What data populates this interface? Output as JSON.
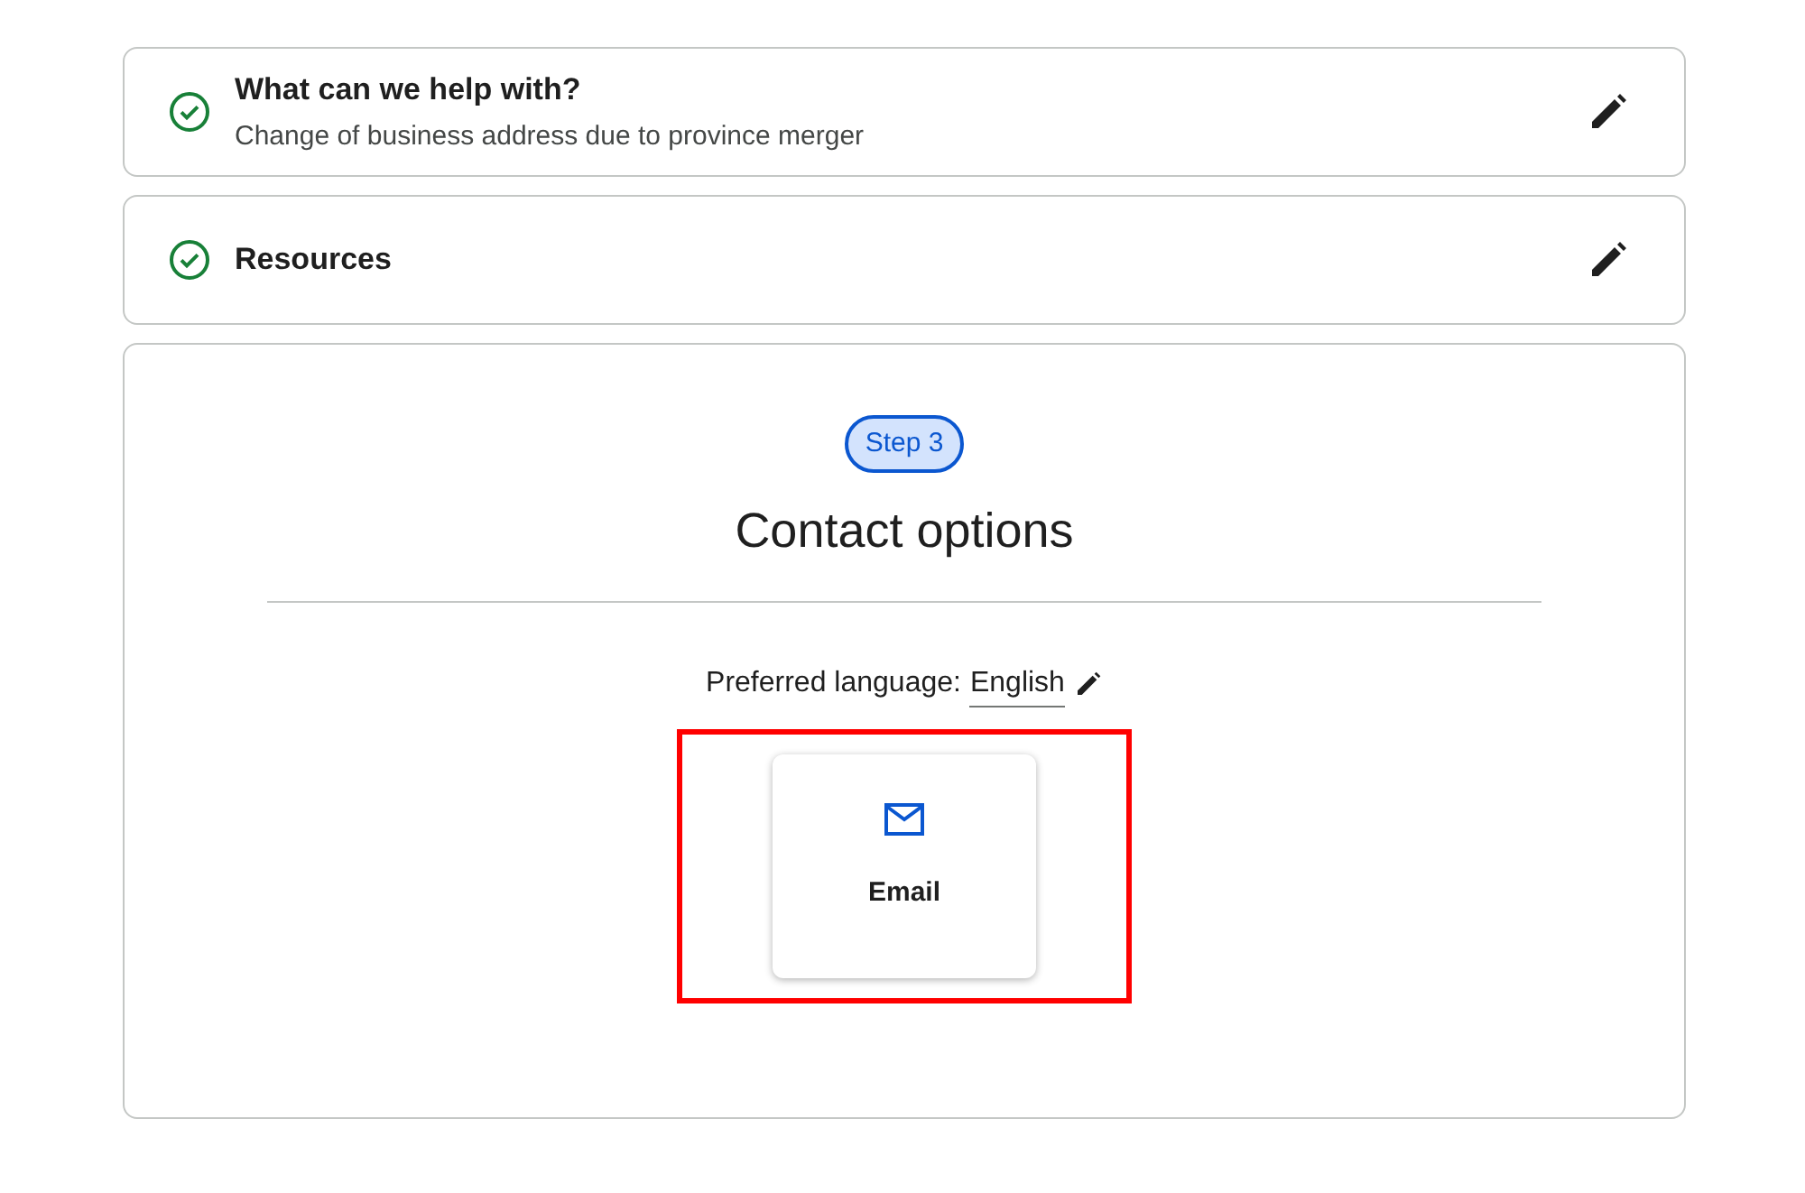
{
  "completed_steps": [
    {
      "title": "What can we help with?",
      "summary": "Change of business address due to province merger",
      "done": true
    },
    {
      "title": "Resources",
      "done": true
    }
  ],
  "current_step": {
    "badge": "Step 3",
    "heading": "Contact options",
    "language_label": "Preferred language:",
    "language": "English",
    "options": [
      {
        "label": "Email",
        "kind": "email",
        "highlighted": true
      }
    ]
  }
}
